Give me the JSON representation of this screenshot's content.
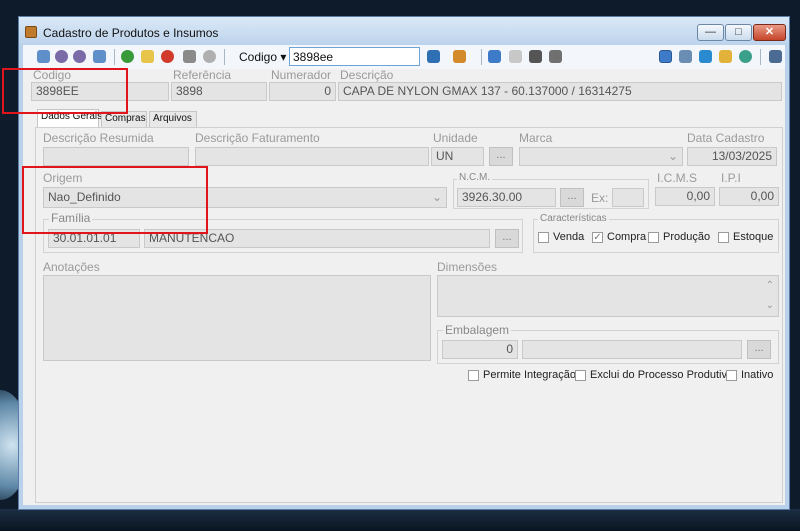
{
  "window": {
    "title": "Cadastro de Produtos e Insumos",
    "minimize": "—",
    "maximize": "□",
    "close": "✕"
  },
  "toolbar": {
    "search_field_label": "Codigo",
    "search_field_caret": "▾",
    "search_value": "3898ee",
    "icons": [
      "save-icon",
      "first-record-icon",
      "previous-record-icon",
      "next-record-icon",
      "add-icon",
      "edit-icon",
      "cancel-icon",
      "print-icon",
      "undo-icon",
      "search-icon",
      "chart-icon",
      "list-icon",
      "document-icon",
      "barcode-icon",
      "tools-icon",
      "screen-icon",
      "key-icon",
      "refresh-icon",
      "label-icon",
      "user-icon",
      "exit-icon"
    ]
  },
  "header": {
    "codigo_label": "Codigo",
    "codigo_value": "3898EE",
    "referencia_label": "Referência",
    "referencia_value": "3898",
    "numerador_label": "Numerador",
    "numerador_value": "0",
    "descricao_label": "Descrição",
    "descricao_value": "CAPA DE NYLON GMAX 137 - 60.137000 / 16314275"
  },
  "tabs": [
    "Dados Gerais",
    "Compras",
    "Arquivos"
  ],
  "dados_gerais": {
    "descricao_resumida_label": "Descrição Resumida",
    "descricao_resumida_value": "",
    "descricao_faturamento_label": "Descrição Faturamento",
    "descricao_faturamento_value": "",
    "unidade_label": "Unidade",
    "unidade_value": "UN",
    "marca_label": "Marca",
    "marca_value": "",
    "data_cadastro_label": "Data Cadastro",
    "data_cadastro_value": "13/03/2025",
    "origem_label": "Origem",
    "origem_value": "Nao_Definido",
    "ncm_label": "N.C.M.",
    "ncm_value": "3926.30.00",
    "ex_label": "Ex:",
    "ex_value": "",
    "icms_label": "I.C.M.S",
    "icms_value": "0,00",
    "ipi_label": "I.P.I",
    "ipi_value": "0,00",
    "familia_label": "Família",
    "familia_code": "30.01.01.01",
    "familia_name": "MANUTENCAO",
    "caracteristicas_label": "Características",
    "caracteristicas": [
      {
        "label": "Venda",
        "checked": false
      },
      {
        "label": "Compra",
        "checked": true
      },
      {
        "label": "Produção",
        "checked": false
      },
      {
        "label": "Estoque",
        "checked": false
      }
    ],
    "anotacoes_label": "Anotações",
    "dimensoes_label": "Dimensões",
    "embalagem_label": "Embalagem",
    "embalagem_value": "0",
    "bottom_checks": [
      {
        "label": "Permite Integração",
        "checked": false
      },
      {
        "label": "Exclui do Processo Produtivo",
        "checked": false
      },
      {
        "label": "Inativo",
        "checked": false
      }
    ],
    "dots_label": "...",
    "check_mark": "✓",
    "dropdown_caret": "⌄",
    "scroll_up": "⌃",
    "scroll_down": "⌄"
  },
  "colors": {
    "highlight": "#e0141a",
    "title_bar": "#bcd3ec",
    "panel_bg": "#f0f0f0"
  }
}
